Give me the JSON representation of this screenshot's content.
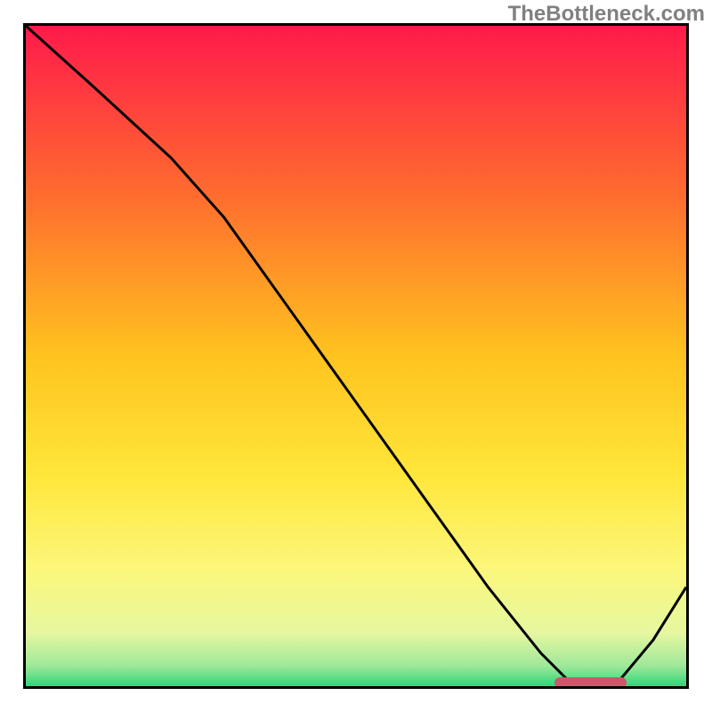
{
  "watermark": "TheBottleneck.com",
  "chart_data": {
    "type": "line",
    "title": "",
    "xlabel": "",
    "ylabel": "",
    "xlim": [
      0,
      100
    ],
    "ylim": [
      0,
      100
    ],
    "series": [
      {
        "name": "bottleneck-curve",
        "x": [
          0,
          10,
          22,
          30,
          40,
          50,
          60,
          70,
          78,
          82,
          86,
          90,
          95,
          100
        ],
        "values": [
          100,
          91,
          80,
          71,
          57,
          43,
          29,
          15,
          5,
          1,
          0,
          1,
          7,
          15
        ]
      }
    ],
    "optimal_marker": {
      "x_start": 80,
      "x_end": 91,
      "y": 0.5
    },
    "gradient_stops": [
      {
        "offset": 0,
        "color": "#ff1a4b"
      },
      {
        "offset": 0.25,
        "color": "#ff6a2f"
      },
      {
        "offset": 0.5,
        "color": "#ffc31f"
      },
      {
        "offset": 0.68,
        "color": "#ffe63a"
      },
      {
        "offset": 0.82,
        "color": "#fcf77a"
      },
      {
        "offset": 0.92,
        "color": "#e6f7a0"
      },
      {
        "offset": 0.97,
        "color": "#9de89a"
      },
      {
        "offset": 1.0,
        "color": "#2fd67a"
      }
    ]
  }
}
